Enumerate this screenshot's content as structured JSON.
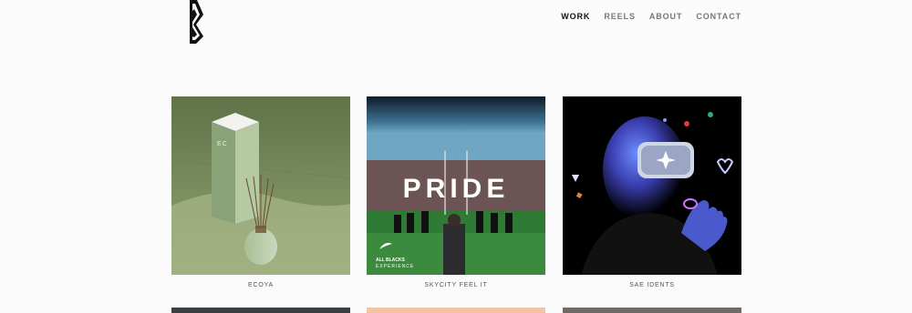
{
  "logo": {
    "icon": "zigzag-logo-icon"
  },
  "nav": {
    "items": [
      {
        "label": "WORK",
        "active": true
      },
      {
        "label": "REELS",
        "active": false
      },
      {
        "label": "ABOUT",
        "active": false
      },
      {
        "label": "CONTACT",
        "active": false
      }
    ]
  },
  "projects": [
    {
      "title": "ECOYA",
      "thumb_text": "ECOYA"
    },
    {
      "title": "SKYCITY FEEL IT",
      "thumb_text": "PRIDE",
      "badge_line1": "ALL BLACKS",
      "badge_line2": "EXPERIENCE"
    },
    {
      "title": "SAE IDENTS"
    }
  ],
  "colors": {
    "nav_active": "#111111",
    "nav_inactive": "#777777",
    "background": "#fbfbfb"
  }
}
